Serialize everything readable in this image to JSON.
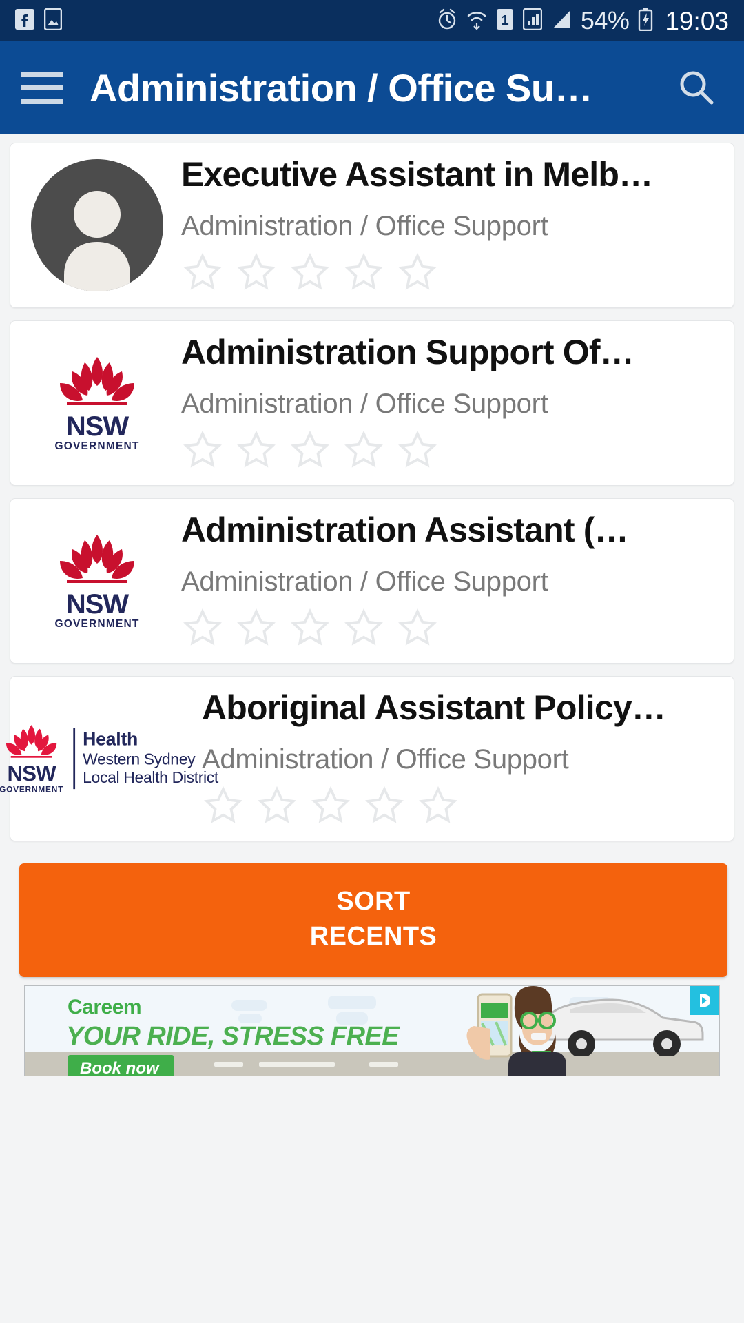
{
  "statusbar": {
    "left_icons": [
      "facebook-icon",
      "gallery-image-icon"
    ],
    "right_icons": [
      "alarm-clock-icon",
      "wifi-icon",
      "sim-1-icon",
      "signal-1-icon",
      "signal-2-icon"
    ],
    "sim_label": "1",
    "battery_percent": "54%",
    "battery_state": "charging",
    "clock": "19:03",
    "background": "#0a2f5e"
  },
  "appbar": {
    "menu_icon": "hamburger-menu-icon",
    "title": "Administration / Office Su…",
    "search_icon": "search-icon",
    "background": "#0c4b94"
  },
  "list": {
    "items": [
      {
        "title": "Executive Assistant in Melb…",
        "category": "Administration / Office Support",
        "rating": 0,
        "max_rating": 5,
        "logo": "default-person-avatar"
      },
      {
        "title": "Administration Support Of…",
        "category": "Administration / Office Support",
        "rating": 0,
        "max_rating": 5,
        "logo": "nsw-government-logo",
        "logo_text": {
          "name": "NSW",
          "sub": "GOVERNMENT"
        }
      },
      {
        "title": "Administration Assistant (…",
        "category": "Administration / Office Support",
        "rating": 0,
        "max_rating": 5,
        "logo": "nsw-government-logo",
        "logo_text": {
          "name": "NSW",
          "sub": "GOVERNMENT"
        }
      },
      {
        "title": "Aboriginal Assistant Policy…",
        "category": "Administration / Office Support",
        "rating": 0,
        "max_rating": 5,
        "logo": "nsw-health-western-sydney-logo",
        "logo_text": {
          "name": "NSW",
          "sub": "GOVERNMENT",
          "brand": "Health",
          "line1": "Western Sydney",
          "line2": "Local Health District"
        }
      }
    ]
  },
  "sort_button": {
    "line1": "SORT",
    "line2": "RECENTS",
    "color": "#f4620d"
  },
  "ad": {
    "brand": "Careem",
    "headline": "YOUR RIDE, STRESS FREE",
    "cta": "Book now",
    "adchoices_icon": "adchoices-icon",
    "brand_color": "#3fae49"
  }
}
